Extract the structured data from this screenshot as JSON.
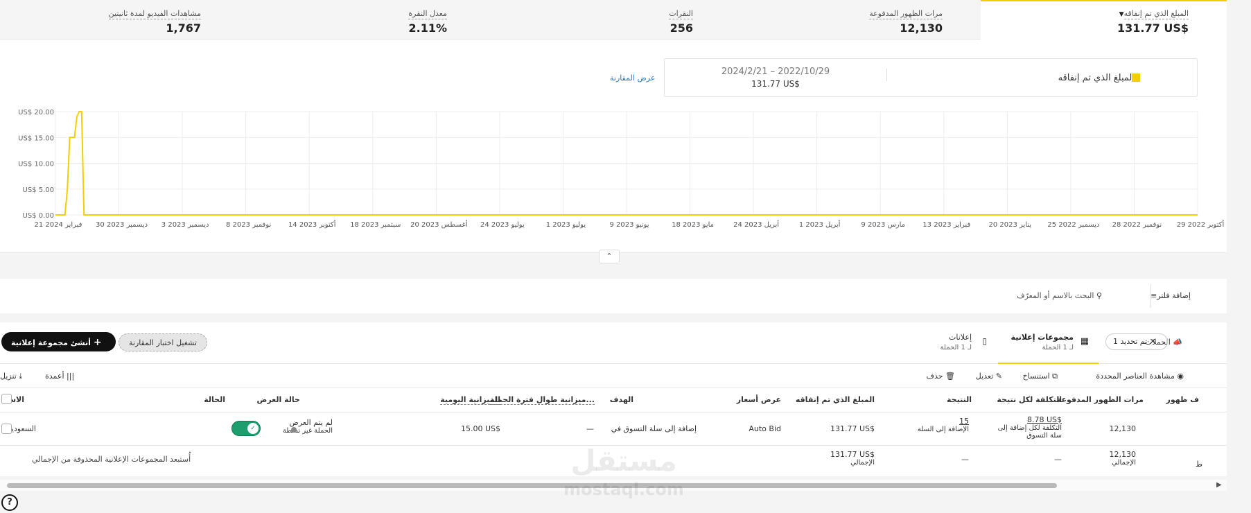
{
  "metrics": [
    {
      "label": "المبلغ الذي تم إنفاقه",
      "value": "131.77 US$"
    },
    {
      "label": "مرات الظهور المدفوعة",
      "value": "12,130"
    },
    {
      "label": "النقرات",
      "value": "256"
    },
    {
      "label": "معدل النقرة",
      "value": "2.11%"
    },
    {
      "label": "مشاهدات الفيديو لمدة ثانيتين",
      "value": "1,767"
    }
  ],
  "legend": {
    "metric_name": "المبلغ الذي تم إنفاقه",
    "date_range": "2024/2/21 – 2022/10/29",
    "total": "131.77 US$",
    "compare_link": "عرض المقارنة",
    "swatch_color": "#f2cf00"
  },
  "chart_data": {
    "type": "line",
    "y_ticks": [
      "US$ 20.00",
      "US$ 15.00",
      "US$ 10.00",
      "US$ 5.00",
      "US$ 0.00"
    ],
    "ylim": [
      0,
      20
    ],
    "x_ticks": [
      "29 أكتوبر 2022",
      "28 نوفمبر 2022",
      "25 ديسمبر 2022",
      "20 يناير 2023",
      "13 فبراير 2023",
      "9 مارس 2023",
      "1 أبريل 2023",
      "24 أبريل 2023",
      "18 مايو 2023",
      "9 يونيو 2023",
      "1 يوليو 2023",
      "24 يوليو 2023",
      "20 أغسطس 2023",
      "18 سبتمبر 2023",
      "14 أكتوبر 2023",
      "8 نوفمبر 2023",
      "3 ديسمبر 2023",
      "30 ديسمبر 2023",
      "21 فبراير 2024"
    ],
    "series": [
      {
        "color": "#f2cf00",
        "x": [
          "2022-10-29",
          "2024-02-09",
          "2024-02-10",
          "2024-02-11",
          "2024-02-12",
          "2024-02-13",
          "2024-02-14",
          "2024-02-15",
          "2024-02-16",
          "2024-02-17",
          "2024-02-18",
          "2024-02-21"
        ],
        "values": [
          0,
          0,
          20,
          20,
          19,
          15,
          15,
          15,
          5,
          0,
          0,
          0
        ]
      }
    ],
    "grid": true
  },
  "collapse_icon": "chevron-up-icon",
  "filter": {
    "add_filter": "إضافة فلتر",
    "search_placeholder": "البحث بالاسم أو المعرّف"
  },
  "tabs": {
    "campaigns": "الحملات",
    "chip": "تم تحديد 1",
    "adsets_title": "مجموعات إعلانية",
    "adsets_sub": "لـ 1 الحملة",
    "ads_title": "إعلانات",
    "ads_sub": "لـ 1 الحملة",
    "ab_test": "تشغيل اختبار المقارنة",
    "create": "أنشئ مجموعة إعلانية"
  },
  "actions": {
    "view_selected": "مشاهدة العناصر المحددة",
    "duplicate": "استنساخ",
    "edit": "تعديل",
    "delete": "حذف",
    "columns": "أعمدة",
    "download": "تنزيل"
  },
  "table": {
    "headers": {
      "reach": "ف ظهور",
      "impressions": "مرات الظهور المدفوعة",
      "cpr": "التكلفة لكل نتيجة",
      "result": "النتيجة",
      "spend": "المبلغ الذي تم إنفاقه",
      "bid": "عرض أسعار",
      "goal": "الهدف",
      "lifetime_budget": "ميزانية طوال فترة الحملة...",
      "daily_budget": "الميزانية اليومية",
      "delivery": "حالة العرض",
      "status": "الحالة",
      "name": "الاسم"
    },
    "row": {
      "impressions": "12,130",
      "cpr_value": "8.78 US$",
      "cpr_sub": "التكلفة لكل إضافة إلى سلة التسوق",
      "result_value": "15",
      "result_sub": "الإضافة إلى السلة",
      "spend": "131.77 US$",
      "bid": "Auto Bid",
      "goal": "إضافة إلى سلة التسوق في",
      "lifetime_budget": "—",
      "daily_budget": "15.00 US$",
      "delivery_title": "لم يتم العرض",
      "delivery_sub": "الحملة غير نشطة",
      "name": "السعودية"
    },
    "totals": {
      "reach": "ط",
      "impressions": "12,130",
      "impressions_label": "الإجمالي",
      "cpr": "—",
      "result": "—",
      "spend": "131.77 US$",
      "spend_label": "الإجمالي",
      "note": "أُستبعد المجموعات الإعلانية المحذوفة من الإجمالي"
    }
  },
  "watermark": {
    "ar": "مستقل",
    "en": "mostaql.com"
  }
}
